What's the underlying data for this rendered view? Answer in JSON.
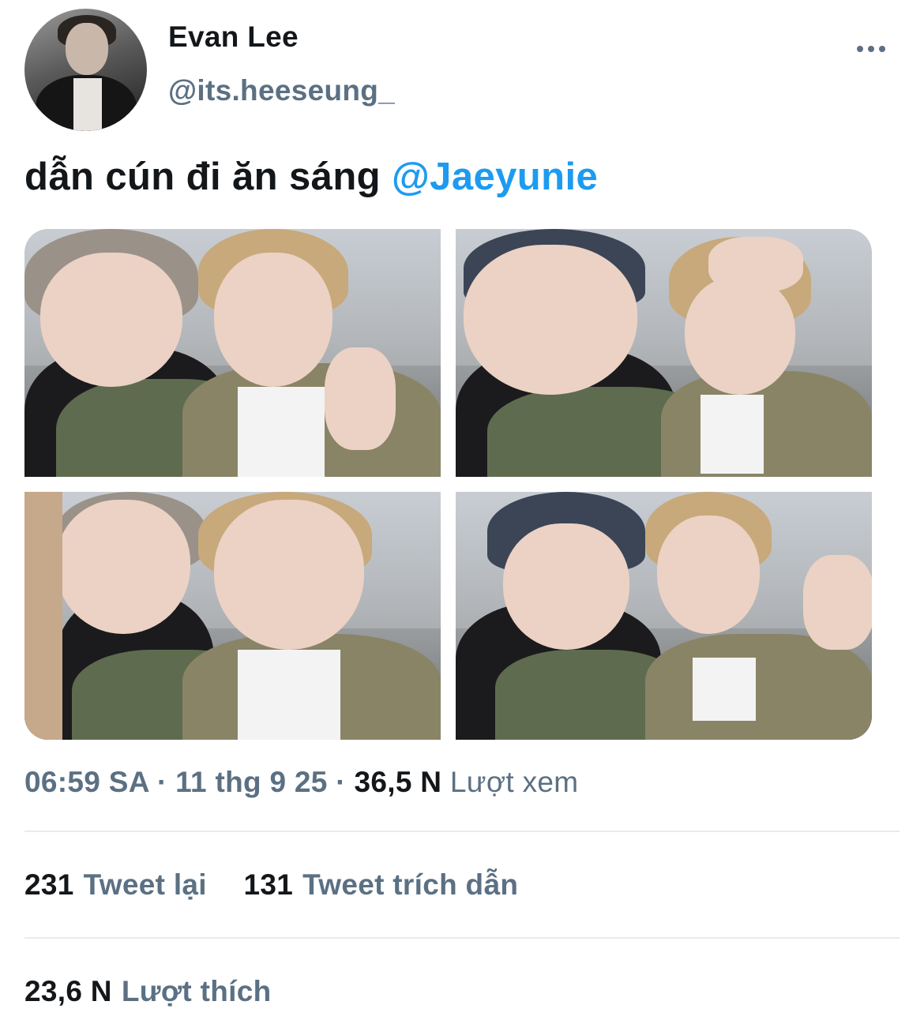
{
  "user": {
    "display_name": "Evan Lee",
    "handle": "@its.heeseung_"
  },
  "tweet": {
    "text": "dẫn cún đi ăn sáng",
    "mention": "@Jaeyunie",
    "media_count": 4
  },
  "meta": {
    "time": "06:59 SA",
    "separator": "·",
    "date": "11 thg 9 25",
    "views_count": "36,5 N",
    "views_label": "Lượt xem"
  },
  "stats": {
    "retweets_count": "231",
    "retweets_label": "Tweet lại",
    "quotes_count": "131",
    "quotes_label": "Tweet trích dẫn",
    "likes_count": "23,6 N",
    "likes_label": "Lượt thích"
  },
  "colors": {
    "text": "#14171a",
    "secondary": "#5b7083",
    "link": "#1d9bf0",
    "divider": "#e6ecf0"
  },
  "icons": {
    "more": "more-horizontal-icon"
  }
}
